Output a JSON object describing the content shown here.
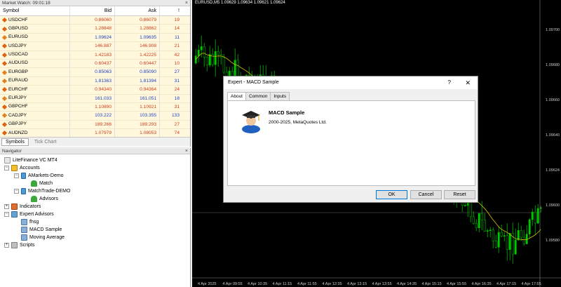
{
  "market_watch": {
    "title": "Market Watch: 09:01:18",
    "columns": {
      "symbol": "Symbol",
      "bid": "Bid",
      "ask": "Ask",
      "spread": "!"
    },
    "rows": [
      {
        "symbol": "USDCHF",
        "bid": "0.86060",
        "ask": "0.86079",
        "spread": "19",
        "dir": "down"
      },
      {
        "symbol": "GBPUSD",
        "bid": "1.28848",
        "ask": "1.28862",
        "spread": "14",
        "dir": "down"
      },
      {
        "symbol": "EURUSD",
        "bid": "1.09624",
        "ask": "1.09635",
        "spread": "11",
        "dir": "up"
      },
      {
        "symbol": "USDJPY",
        "bid": "146.887",
        "ask": "146.908",
        "spread": "21",
        "dir": "down"
      },
      {
        "symbol": "USDCAD",
        "bid": "1.42183",
        "ask": "1.42225",
        "spread": "42",
        "dir": "down"
      },
      {
        "symbol": "AUDUSD",
        "bid": "0.60437",
        "ask": "0.60447",
        "spread": "10",
        "dir": "down"
      },
      {
        "symbol": "EURGBP",
        "bid": "0.85063",
        "ask": "0.85090",
        "spread": "27",
        "dir": "up"
      },
      {
        "symbol": "EURAUD",
        "bid": "1.81363",
        "ask": "1.81394",
        "spread": "31",
        "dir": "up"
      },
      {
        "symbol": "EURCHF",
        "bid": "0.94340",
        "ask": "0.94364",
        "spread": "24",
        "dir": "down"
      },
      {
        "symbol": "EURJPY",
        "bid": "161.033",
        "ask": "161.051",
        "spread": "18",
        "dir": "up"
      },
      {
        "symbol": "GBPCHF",
        "bid": "1.10890",
        "ask": "1.10921",
        "spread": "31",
        "dir": "down"
      },
      {
        "symbol": "CADJPY",
        "bid": "103.222",
        "ask": "103.355",
        "spread": "133",
        "dir": "up"
      },
      {
        "symbol": "GBPJPY",
        "bid": "189.266",
        "ask": "189.293",
        "spread": "27",
        "dir": "down"
      },
      {
        "symbol": "AUDNZD",
        "bid": "1.07979",
        "ask": "1.08053",
        "spread": "74",
        "dir": "down"
      }
    ],
    "tabs": [
      "Symbols",
      "Tick Chart"
    ]
  },
  "navigator": {
    "title": "Navigator",
    "root": "LiteFinance VC MT4",
    "accounts": "Accounts",
    "account1": "AMarkets-Demo",
    "account1_user": "Match",
    "account2": "MatchTrade-DEMO",
    "account2_user": "Advisors",
    "indicators": "Indicators",
    "expert_advisors": "Expert Advisors",
    "ea1": "fhsg",
    "ea2": "MACD Sample",
    "ea3": "Moving Average",
    "scripts": "Scripts"
  },
  "chart": {
    "title": "EURUSD,M5  1.09629 1.09634 1.09621 1.09624",
    "price_labels": [
      "1.09700",
      "1.09680",
      "1.09660",
      "1.09640",
      "1.09624",
      "1.09600",
      "1.09580"
    ],
    "time_labels": [
      "4 Apr 2025",
      "4 Apr 09:55",
      "4 Apr 10:35",
      "4 Apr 11:15",
      "4 Apr 11:55",
      "4 Apr 12:35",
      "4 Apr 13:15",
      "4 Apr 13:55",
      "4 Apr 14:35",
      "4 Apr 15:15",
      "4 Apr 15:55",
      "4 Apr 16:35",
      "4 Apr 17:15",
      "4 Apr 17:55"
    ],
    "colors": {
      "bull": "#00c800",
      "bear": "#00c800",
      "ma": "#d4c000",
      "hline": "#666666"
    }
  },
  "dialog": {
    "title": "Expert - MACD Sample",
    "help": "?",
    "close": "✕",
    "tabs": [
      "About",
      "Common",
      "Inputs"
    ],
    "ea_name": "MACD Sample",
    "copyright": "2000-2025, MetaQuotes Ltd.",
    "ok": "OK",
    "cancel": "Cancel",
    "reset": "Reset"
  }
}
